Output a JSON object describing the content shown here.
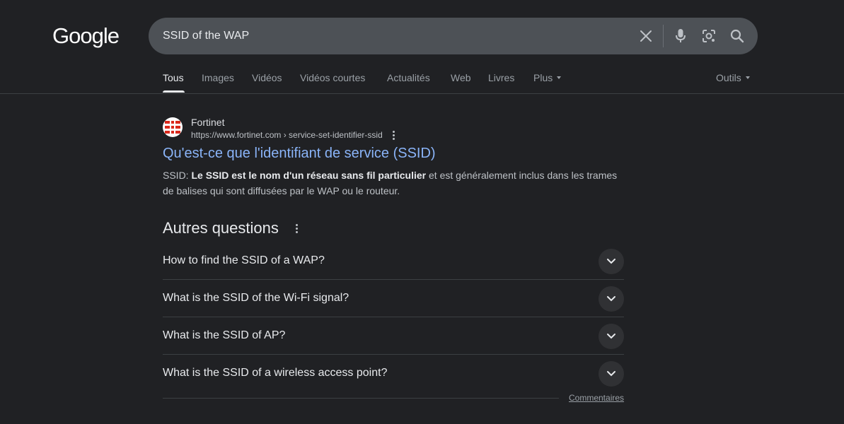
{
  "logo": {
    "text": "Google"
  },
  "search": {
    "query": "SSID of the WAP",
    "icons": [
      "close-icon",
      "microphone-icon",
      "lens-icon",
      "search-icon"
    ]
  },
  "tabs": [
    {
      "label": "Tous",
      "active": true
    },
    {
      "label": "Images"
    },
    {
      "label": "Vidéos"
    },
    {
      "label": "Vidéos courtes"
    },
    {
      "label": "Actualités"
    },
    {
      "label": "Web"
    },
    {
      "label": "Livres"
    },
    {
      "label": "Plus"
    }
  ],
  "tools_label": "Outils",
  "result": {
    "site_name": "Fortinet",
    "url": "https://www.fortinet.com › service-set-identifier-ssid",
    "title": "Qu'est-ce que l'identifiant de service (SSID)",
    "snippet_prefix": "SSID: ",
    "snippet_bold": "Le SSID est le nom d'un réseau sans fil particulier",
    "snippet_rest": " et est généralement inclus dans les trames de balises qui sont diffusées par le WAP ou le routeur."
  },
  "paa": {
    "heading": "Autres questions",
    "questions": [
      "How to find the SSID of a WAP?",
      "What is the SSID of the Wi-Fi signal?",
      "What is the SSID of AP?",
      "What is the SSID of a wireless access point?"
    ]
  },
  "feedback_label": "Commentaires",
  "colors": {
    "background": "#202124",
    "link": "#8ab4f8",
    "searchbox": "#4d5156"
  }
}
